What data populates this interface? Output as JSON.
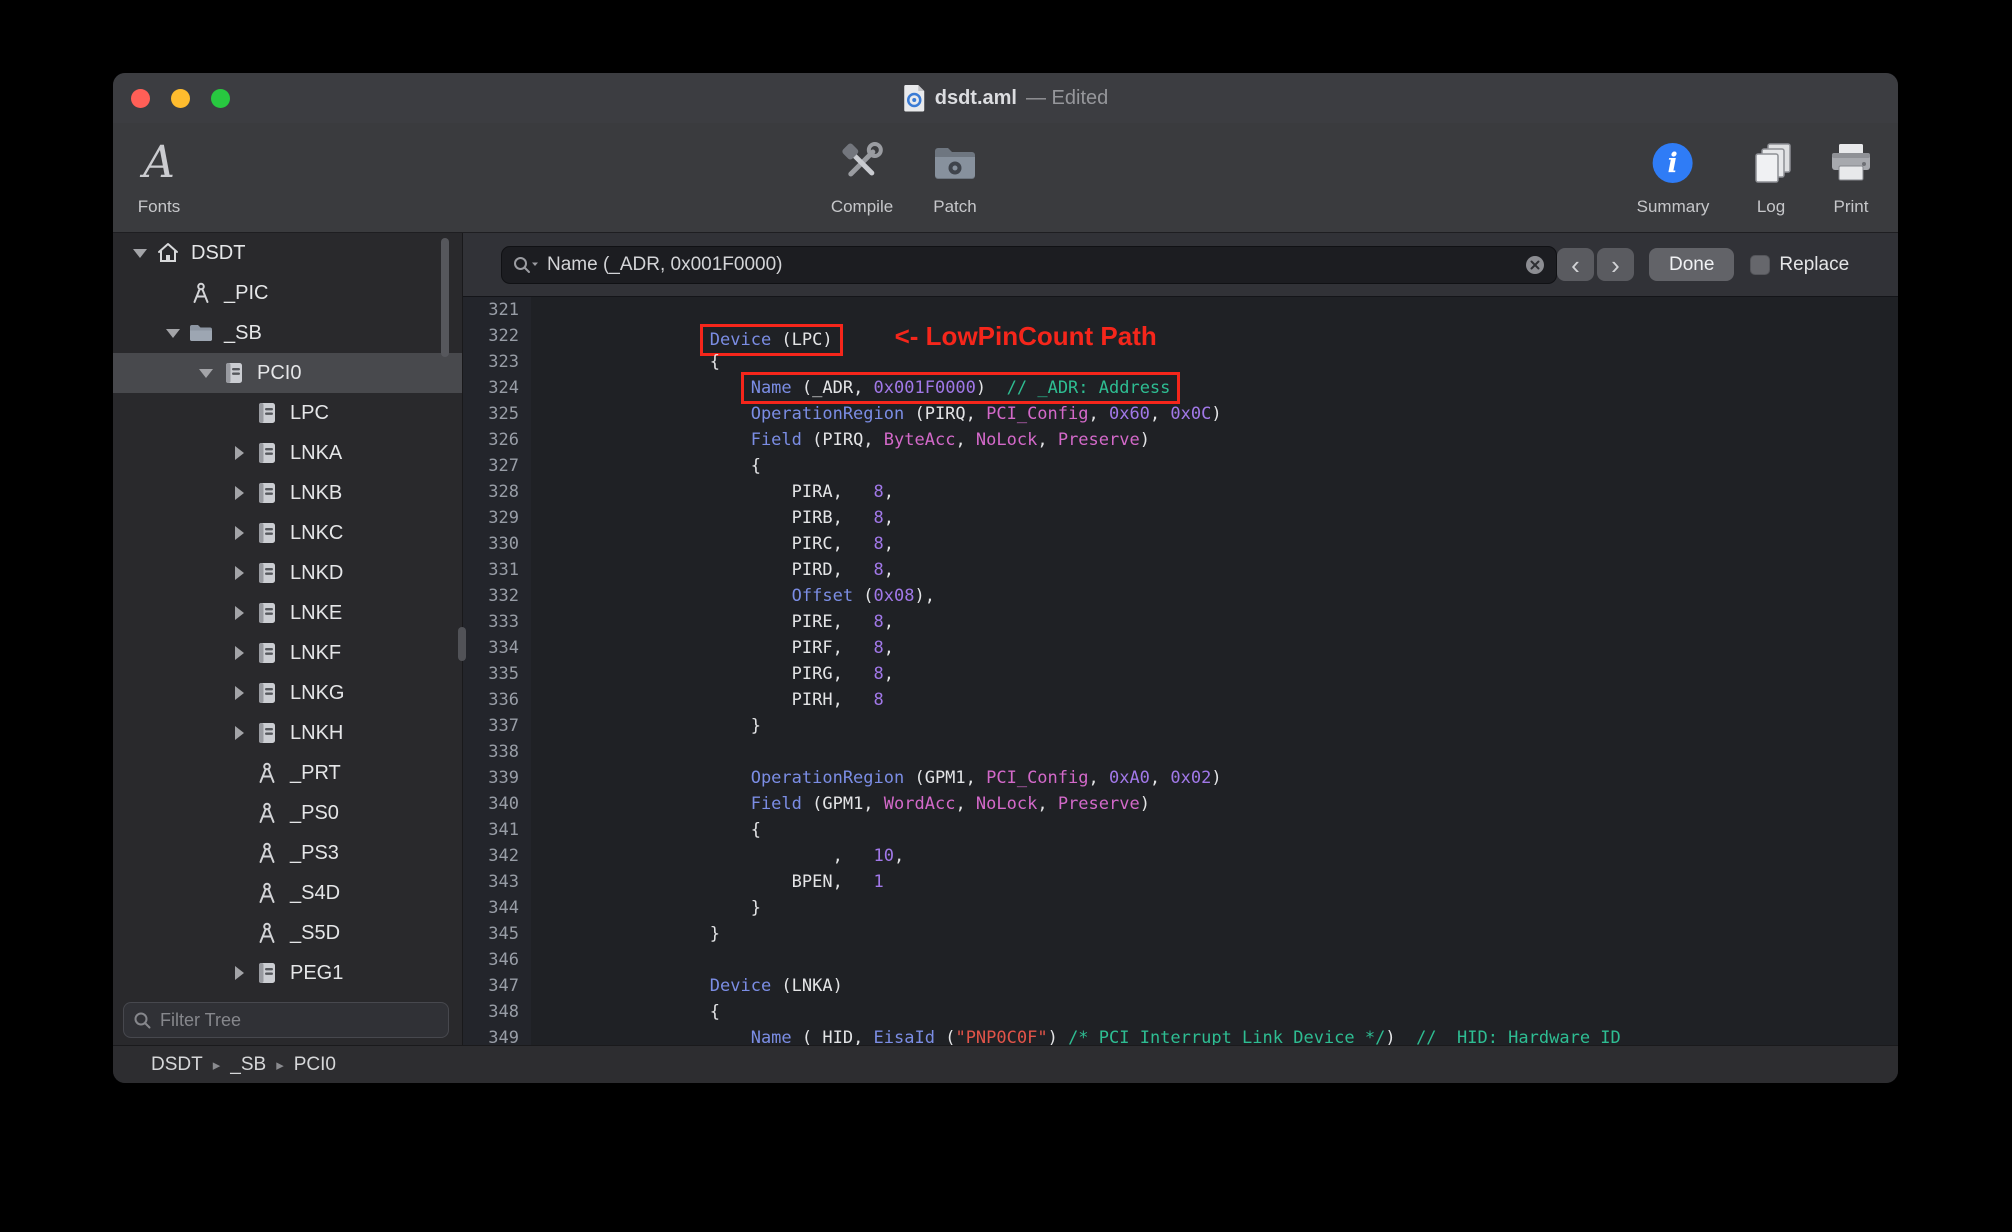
{
  "window": {
    "title": "dsdt.aml",
    "edited_suffix": "— Edited"
  },
  "toolbar": {
    "fonts": "Fonts",
    "compile": "Compile",
    "patch": "Patch",
    "summary": "Summary",
    "log": "Log",
    "print": "Print"
  },
  "find_bar": {
    "search_value": "Name (_ADR, 0x001F0000)",
    "prev": "‹",
    "next": "›",
    "done": "Done",
    "replace": "Replace"
  },
  "sidebar": {
    "filter_placeholder": "Filter Tree",
    "items": [
      {
        "label": "DSDT",
        "indent": 0,
        "icon": "home",
        "disclosure": "open"
      },
      {
        "label": "_PIC",
        "indent": 1,
        "icon": "method",
        "disclosure": "none"
      },
      {
        "label": "_SB",
        "indent": 1,
        "icon": "folder",
        "disclosure": "open"
      },
      {
        "label": "PCI0",
        "indent": 2,
        "icon": "device",
        "disclosure": "open",
        "selected": true
      },
      {
        "label": "LPC",
        "indent": 3,
        "icon": "device",
        "disclosure": "none"
      },
      {
        "label": "LNKA",
        "indent": 3,
        "icon": "device",
        "disclosure": "closed"
      },
      {
        "label": "LNKB",
        "indent": 3,
        "icon": "device",
        "disclosure": "closed"
      },
      {
        "label": "LNKC",
        "indent": 3,
        "icon": "device",
        "disclosure": "closed"
      },
      {
        "label": "LNKD",
        "indent": 3,
        "icon": "device",
        "disclosure": "closed"
      },
      {
        "label": "LNKE",
        "indent": 3,
        "icon": "device",
        "disclosure": "closed"
      },
      {
        "label": "LNKF",
        "indent": 3,
        "icon": "device",
        "disclosure": "closed"
      },
      {
        "label": "LNKG",
        "indent": 3,
        "icon": "device",
        "disclosure": "closed"
      },
      {
        "label": "LNKH",
        "indent": 3,
        "icon": "device",
        "disclosure": "closed"
      },
      {
        "label": "_PRT",
        "indent": 3,
        "icon": "method",
        "disclosure": "none"
      },
      {
        "label": "_PS0",
        "indent": 3,
        "icon": "method",
        "disclosure": "none"
      },
      {
        "label": "_PS3",
        "indent": 3,
        "icon": "method",
        "disclosure": "none"
      },
      {
        "label": "_S4D",
        "indent": 3,
        "icon": "method",
        "disclosure": "none"
      },
      {
        "label": "_S5D",
        "indent": 3,
        "icon": "method",
        "disclosure": "none"
      },
      {
        "label": "PEG1",
        "indent": 3,
        "icon": "device",
        "disclosure": "closed"
      }
    ]
  },
  "breadcrumb": [
    "DSDT",
    "_SB",
    "PCI0"
  ],
  "editor": {
    "annotation": "<- LowPinCount Path",
    "lines": [
      {
        "num": 321,
        "segs": []
      },
      {
        "num": 322,
        "segs": [
          [
            "                ",
            "p"
          ],
          [
            "Device",
            "k"
          ],
          [
            " (LPC)",
            "p"
          ]
        ],
        "box": [
          1,
          2
        ],
        "note": true
      },
      {
        "num": 323,
        "segs": [
          [
            "                {",
            "p"
          ]
        ]
      },
      {
        "num": 324,
        "segs": [
          [
            "                    ",
            "p"
          ],
          [
            "Name",
            "k"
          ],
          [
            " (_ADR, ",
            "p"
          ],
          [
            "0x001F0000",
            "n"
          ],
          [
            ")",
            "p"
          ],
          [
            "  ",
            "p"
          ],
          [
            "// _ADR: Address",
            "c"
          ]
        ],
        "box": [
          1,
          6
        ]
      },
      {
        "num": 325,
        "segs": [
          [
            "                    ",
            "p"
          ],
          [
            "OperationRegion",
            "k"
          ],
          [
            " (PIRQ, ",
            "p"
          ],
          [
            "PCI_Config",
            "m"
          ],
          [
            ", ",
            "p"
          ],
          [
            "0x60",
            "n"
          ],
          [
            ", ",
            "p"
          ],
          [
            "0x0C",
            "n"
          ],
          [
            ")",
            "p"
          ]
        ]
      },
      {
        "num": 326,
        "segs": [
          [
            "                    ",
            "p"
          ],
          [
            "Field",
            "k"
          ],
          [
            " (PIRQ, ",
            "p"
          ],
          [
            "ByteAcc",
            "m"
          ],
          [
            ", ",
            "p"
          ],
          [
            "NoLock",
            "m"
          ],
          [
            ", ",
            "p"
          ],
          [
            "Preserve",
            "m"
          ],
          [
            ")",
            "p"
          ]
        ]
      },
      {
        "num": 327,
        "segs": [
          [
            "                    {",
            "p"
          ]
        ]
      },
      {
        "num": 328,
        "segs": [
          [
            "                        PIRA,   ",
            "p"
          ],
          [
            "8",
            "n"
          ],
          [
            ",",
            "p"
          ]
        ]
      },
      {
        "num": 329,
        "segs": [
          [
            "                        PIRB,   ",
            "p"
          ],
          [
            "8",
            "n"
          ],
          [
            ",",
            "p"
          ]
        ]
      },
      {
        "num": 330,
        "segs": [
          [
            "                        PIRC,   ",
            "p"
          ],
          [
            "8",
            "n"
          ],
          [
            ",",
            "p"
          ]
        ]
      },
      {
        "num": 331,
        "segs": [
          [
            "                        PIRD,   ",
            "p"
          ],
          [
            "8",
            "n"
          ],
          [
            ",",
            "p"
          ]
        ]
      },
      {
        "num": 332,
        "segs": [
          [
            "                        ",
            "p"
          ],
          [
            "Offset",
            "k"
          ],
          [
            " (",
            "p"
          ],
          [
            "0x08",
            "n"
          ],
          [
            "),",
            "p"
          ]
        ]
      },
      {
        "num": 333,
        "segs": [
          [
            "                        PIRE,   ",
            "p"
          ],
          [
            "8",
            "n"
          ],
          [
            ",",
            "p"
          ]
        ]
      },
      {
        "num": 334,
        "segs": [
          [
            "                        PIRF,   ",
            "p"
          ],
          [
            "8",
            "n"
          ],
          [
            ",",
            "p"
          ]
        ]
      },
      {
        "num": 335,
        "segs": [
          [
            "                        PIRG,   ",
            "p"
          ],
          [
            "8",
            "n"
          ],
          [
            ",",
            "p"
          ]
        ]
      },
      {
        "num": 336,
        "segs": [
          [
            "                        PIRH,   ",
            "p"
          ],
          [
            "8",
            "n"
          ]
        ]
      },
      {
        "num": 337,
        "segs": [
          [
            "                    }",
            "p"
          ]
        ]
      },
      {
        "num": 338,
        "segs": []
      },
      {
        "num": 339,
        "segs": [
          [
            "                    ",
            "p"
          ],
          [
            "OperationRegion",
            "k"
          ],
          [
            " (GPM1, ",
            "p"
          ],
          [
            "PCI_Config",
            "m"
          ],
          [
            ", ",
            "p"
          ],
          [
            "0xA0",
            "n"
          ],
          [
            ", ",
            "p"
          ],
          [
            "0x02",
            "n"
          ],
          [
            ")",
            "p"
          ]
        ]
      },
      {
        "num": 340,
        "segs": [
          [
            "                    ",
            "p"
          ],
          [
            "Field",
            "k"
          ],
          [
            " (GPM1, ",
            "p"
          ],
          [
            "WordAcc",
            "m"
          ],
          [
            ", ",
            "p"
          ],
          [
            "NoLock",
            "m"
          ],
          [
            ", ",
            "p"
          ],
          [
            "Preserve",
            "m"
          ],
          [
            ")",
            "p"
          ]
        ]
      },
      {
        "num": 341,
        "segs": [
          [
            "                    {",
            "p"
          ]
        ]
      },
      {
        "num": 342,
        "segs": [
          [
            "                            ,   ",
            "p"
          ],
          [
            "10",
            "n"
          ],
          [
            ",",
            "p"
          ]
        ]
      },
      {
        "num": 343,
        "segs": [
          [
            "                        BPEN,   ",
            "p"
          ],
          [
            "1",
            "n"
          ]
        ]
      },
      {
        "num": 344,
        "segs": [
          [
            "                    }",
            "p"
          ]
        ]
      },
      {
        "num": 345,
        "segs": [
          [
            "                }",
            "p"
          ]
        ]
      },
      {
        "num": 346,
        "segs": []
      },
      {
        "num": 347,
        "segs": [
          [
            "                ",
            "p"
          ],
          [
            "Device",
            "k"
          ],
          [
            " (LNKA)",
            "p"
          ]
        ]
      },
      {
        "num": 348,
        "segs": [
          [
            "                {",
            "p"
          ]
        ]
      },
      {
        "num": 349,
        "segs": [
          [
            "                    ",
            "p"
          ],
          [
            "Name",
            "k"
          ],
          [
            " (_HID, ",
            "p"
          ],
          [
            "EisaId",
            "k"
          ],
          [
            " (",
            "p"
          ],
          [
            "\"PNP0C0F\"",
            "s"
          ],
          [
            ") ",
            "p"
          ],
          [
            "/* PCI Interrupt Link Device */",
            "c"
          ],
          [
            ")  ",
            "p"
          ],
          [
            "// _HID: Hardware ID",
            "c"
          ]
        ]
      }
    ]
  },
  "colors": {
    "keyword": "#7b8de4",
    "number": "#a178e8",
    "type": "#d369c9",
    "comment": "#2ebd92",
    "string": "#e25449",
    "plain": "#e3e4e6",
    "annotation_red": "#f5261b",
    "accent_blue": "#2f7cf6",
    "close_red": "#ff5f57",
    "minimize_yellow": "#febc2e",
    "zoom_green": "#28c840"
  }
}
